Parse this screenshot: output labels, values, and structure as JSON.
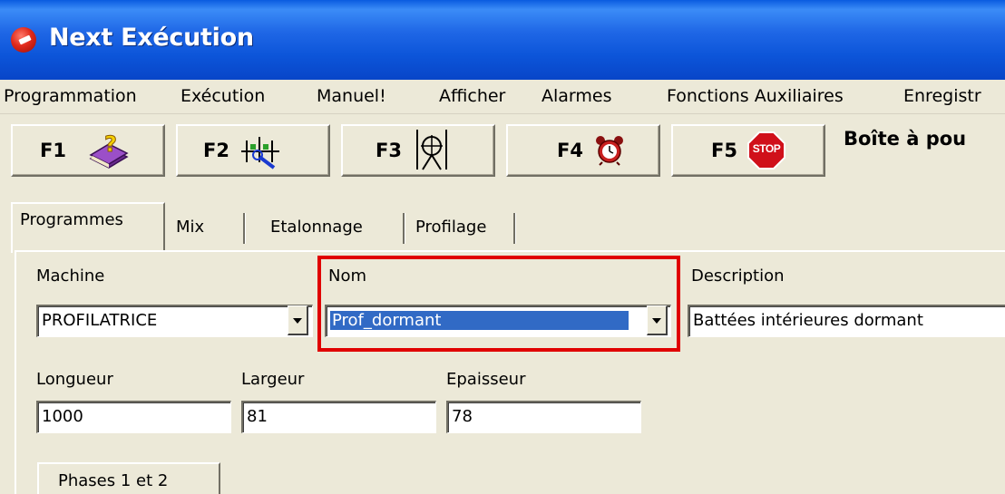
{
  "window": {
    "title": "Next Exécution"
  },
  "menubar": {
    "items": [
      "Programmation",
      "Exécution",
      "Manuel!",
      "Afficher",
      "Alarmes",
      "Fonctions Auxiliaires",
      "Enregistr"
    ]
  },
  "toolbar": {
    "buttons": [
      {
        "key": "F1",
        "icon": "help-book-icon"
      },
      {
        "key": "F2",
        "icon": "calibration-icon"
      },
      {
        "key": "F3",
        "icon": "measure-icon"
      },
      {
        "key": "F4",
        "icon": "alarm-clock-icon"
      },
      {
        "key": "F5",
        "icon": "stop-sign-icon",
        "icon_text": "STOP"
      }
    ],
    "toolbox_label": "Boîte à pou"
  },
  "tabs": [
    "Programmes",
    "Mix",
    "Etalonnage",
    "Profilage"
  ],
  "form": {
    "machine": {
      "label": "Machine",
      "value": "PROFILATRICE"
    },
    "nom": {
      "label": "Nom",
      "value": "Prof_dormant"
    },
    "description": {
      "label": "Description",
      "value": "Battées intérieures dormant"
    },
    "longueur": {
      "label": "Longueur",
      "value": "1000"
    },
    "largeur": {
      "label": "Largeur",
      "value": "81"
    },
    "epaisseur": {
      "label": "Epaisseur",
      "value": "78"
    }
  },
  "subtabs": [
    "Phases 1 et 2"
  ],
  "colors": {
    "titlebar": "#0c55d9",
    "highlight": "#e00000",
    "selection": "#316ac5",
    "stop": "#d0101a"
  }
}
